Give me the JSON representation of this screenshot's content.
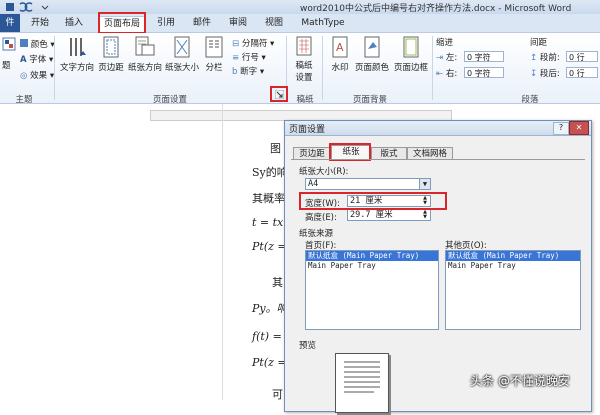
{
  "window": {
    "title": "word2010中公式后中编号右对齐操作方法.docx - Microsoft Word"
  },
  "tabs": [
    {
      "label": "件"
    },
    {
      "label": "开始"
    },
    {
      "label": "插入"
    },
    {
      "label": "页面布局"
    },
    {
      "label": "引用"
    },
    {
      "label": "邮件"
    },
    {
      "label": "审阅"
    },
    {
      "label": "视图"
    },
    {
      "label": "MathType"
    }
  ],
  "ribbon": {
    "theme_group": {
      "label": "主题",
      "colors": "颜色",
      "fonts": "字体",
      "effects": "效果",
      "theme_small": "题"
    },
    "page_setup_group": {
      "label": "页面设置",
      "text_direction": "文字方向",
      "margins": "页边距",
      "orientation": "纸张方向",
      "size": "纸张大小",
      "columns": "分栏",
      "breaks": "分隔符",
      "line_numbers": "行号",
      "hyphenation": "断字"
    },
    "draft_group": {
      "label": "稿纸",
      "draft_settings_1": "稿纸",
      "draft_settings_2": "设置"
    },
    "background_group": {
      "label": "页面背景",
      "watermark": "水印",
      "page_color": "页面颜色",
      "page_borders": "页面边框"
    },
    "indent_group": {
      "label": "缩进",
      "left_label": "左:",
      "left_value": "0 字符",
      "right_label": "右:",
      "right_value": "0 字符"
    },
    "spacing_group": {
      "label": "间距",
      "before_label": "段前:",
      "before_value": "0 行",
      "after_label": "段后:",
      "after_value": "0 行"
    },
    "paragraph_label": "段落"
  },
  "document": {
    "lines": [
      {
        "text": "图"
      },
      {
        "text": "Sy的响"
      },
      {
        "text": "其概率"
      },
      {
        "text": "t = tx +"
      },
      {
        "text": "Pt(z ="
      },
      {
        "text": "其"
      },
      {
        "text": "Py。响"
      },
      {
        "text": "f(t) ="
      },
      {
        "text": "Pt(z ="
      },
      {
        "text": "可"
      }
    ]
  },
  "dialog": {
    "title": "页面设置",
    "help": "?",
    "close": "✕",
    "tabs": [
      {
        "label": "页边距"
      },
      {
        "label": "纸张"
      },
      {
        "label": "版式"
      },
      {
        "label": "文档网格"
      }
    ],
    "paper_size_label": "纸张大小(R):",
    "paper_size_value": "A4",
    "width_label": "宽度(W):",
    "width_value": "21 厘米",
    "height_label": "高度(E):",
    "height_value": "29.7 厘米",
    "paper_source_label": "纸张来源",
    "first_page_label": "首页(F):",
    "other_pages_label": "其他页(O):",
    "first_page_options": [
      "默认纸盒 (Main Paper Tray)",
      "Main Paper Tray"
    ],
    "other_pages_options": [
      "默认纸盒 (Main Paper Tray)",
      "Main Paper Tray"
    ],
    "preview_label": "预览"
  },
  "watermark_text": "头条 @不懂说晚安",
  "colors": {
    "highlight_red": "#d9262a",
    "file_tab": "#2b5797",
    "selection_blue": "#3875d7"
  }
}
